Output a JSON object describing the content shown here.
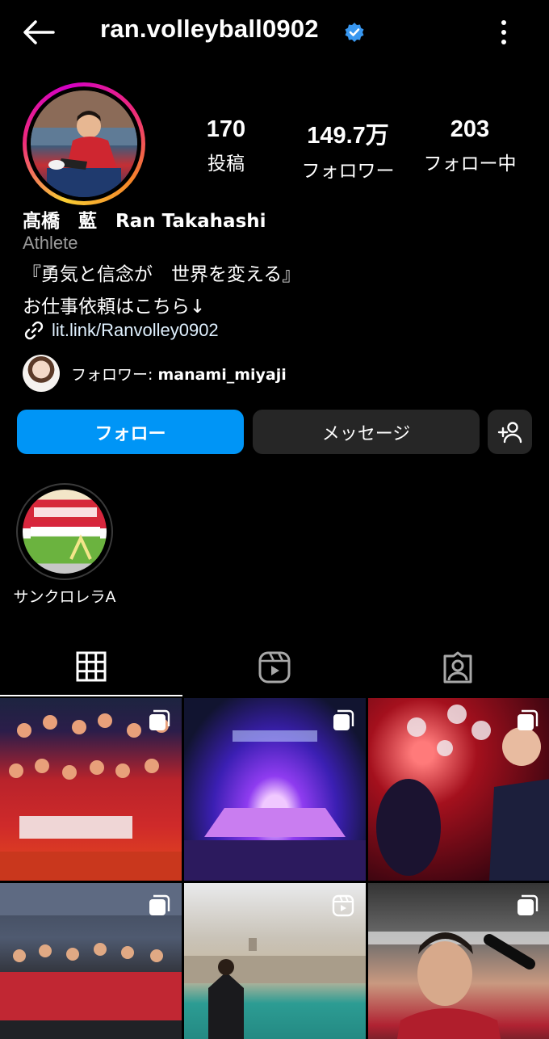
{
  "header": {
    "username": "ran.volleyball0902",
    "verified_icon": "verified-badge-icon",
    "back_icon": "arrow-left-icon",
    "more_icon": "more-vertical-icon"
  },
  "profile": {
    "stats": [
      {
        "value": "170",
        "label": "投稿"
      },
      {
        "value": "149.7万",
        "label": "フォロワー"
      },
      {
        "value": "203",
        "label": "フォロー中"
      }
    ],
    "full_name": "髙橋　藍　Ran Takahashi",
    "category": "Athlete",
    "bio": [
      "『勇気と信念が　世界を変える』",
      "お仕事依頼はこちら↓"
    ],
    "link": "lit.link/Ranvolley0902",
    "mutual": {
      "prefix": "フォロワー: ",
      "name": "manami_miyaji"
    }
  },
  "actions": {
    "follow": "フォロー",
    "message": "メッセージ",
    "add_user_icon": "add-user-icon"
  },
  "highlights": [
    {
      "label": "サンクロレラA"
    }
  ],
  "tabs": [
    "grid-icon",
    "reels-icon",
    "tagged-icon"
  ],
  "colors": {
    "background": "#000000",
    "accent": "#0095f6",
    "secondary_button": "#262626",
    "verified": "#3897f0",
    "muted_text": "#9b9b9b"
  },
  "grid_posts": [
    {
      "type": "carousel"
    },
    {
      "type": "carousel"
    },
    {
      "type": "carousel"
    },
    {
      "type": "carousel"
    },
    {
      "type": "reel"
    },
    {
      "type": "carousel"
    }
  ]
}
